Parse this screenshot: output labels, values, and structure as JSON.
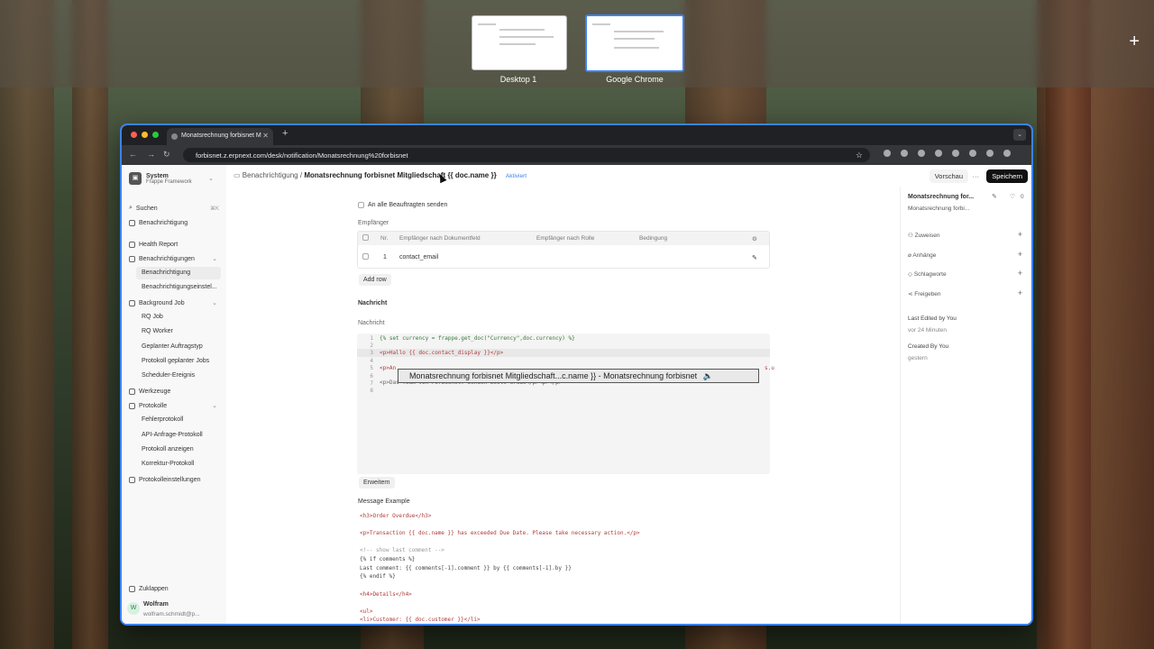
{
  "mission_control": {
    "spaces": [
      {
        "label": "Desktop 1"
      },
      {
        "label": "Google Chrome"
      }
    ],
    "add_label": "+"
  },
  "browser": {
    "tab_title": "Monatsrechnung forbisnet M",
    "url": "forbisnet.z.erpnext.com/desk/notification/Monatsrechnung%20forbisnet"
  },
  "sidebar": {
    "org": "System",
    "org_sub": "Frappe Framework",
    "search": "Suchen",
    "search_shortcut": "⌘K",
    "items": [
      {
        "label": "Benachrichtigung"
      },
      {
        "label": "Health Report"
      },
      {
        "label": "Benachrichtigungen"
      },
      {
        "label": "Benachrichtigung"
      },
      {
        "label": "Benachrichtigungseinstel..."
      },
      {
        "label": "Background Job"
      },
      {
        "label": "RQ Job"
      },
      {
        "label": "RQ Worker"
      },
      {
        "label": "Geplanter Auftragstyp"
      },
      {
        "label": "Protokoll geplanter Jobs"
      },
      {
        "label": "Scheduler-Ereignis"
      },
      {
        "label": "Werkzeuge"
      },
      {
        "label": "Protokolle"
      },
      {
        "label": "Fehlerprotokoll"
      },
      {
        "label": "API-Anfrage-Protokoll"
      },
      {
        "label": "Protokoll anzeigen"
      },
      {
        "label": "Korrektur-Protokoll"
      },
      {
        "label": "Protokolleinstellungen"
      }
    ],
    "collapse": "Zuklappen",
    "user_name": "Wolfram",
    "user_email": "wolfram.schmidt@p...",
    "user_initial": "W"
  },
  "header": {
    "breadcrumb_parent": "Benachrichtigung",
    "separator": "/",
    "title": "Monatsrechnung forbisnet Mitgliedschaft {{ doc.name }}",
    "status": "Aktiviert",
    "preview": "Vorschau",
    "more": "···",
    "save": "Speichern"
  },
  "form": {
    "send_all_label": "An alle Beauftragten senden",
    "recipients_label": "Empfänger",
    "grid_headers": [
      "Nr.",
      "Empfänger nach Dokumentfeld",
      "Empfänger nach Rolle",
      "Bedingung"
    ],
    "grid_rows": [
      {
        "no": "1",
        "field": "contact_email",
        "role": "",
        "condition": ""
      }
    ],
    "add_row": "Add row",
    "message_section": "Nachricht",
    "message_label": "Nachricht",
    "code_lines": [
      "1",
      "2",
      "3",
      "4",
      "5",
      "6",
      "7",
      "8"
    ],
    "code_line1": "{% set currency = frappe.get_doc(\"Currency\",doc.currency) %}",
    "code_line3": "<p>Hallo {{ doc.contact_display }}</p>",
    "code_line5_start": "<p>An",
    "code_line5_end": "s.u",
    "code_line6": "<p>Das Team von Forbisnet. Senden beste Grüße</p><p></p>",
    "tooltip": "Monatsrechnung forbisnet Mitgliedschaft...c.name }} - Monatsrechnung forbisnet",
    "expand": "Erweitern",
    "example_title": "Message Example",
    "example_lines": [
      "<h3>Order Overdue</h3>",
      "<p>Transaction {{ doc.name }} has exceeded Due Date. Please take necessary action.</p>",
      "<!-- show last comment -->",
      "{% if comments %}",
      "Last comment: {{ comments[-1].comment }} by {{ comments[-1].by }}",
      "{% endif %}",
      "<h4>Details</h4>",
      "<ul>",
      "<li>Customer: {{ doc.customer }}</li>"
    ]
  },
  "right_panel": {
    "title": "Monatsrechnung for...",
    "subtitle": "Monatsrechnung forbi...",
    "likes": "0",
    "actions": [
      "Zuweisen",
      "Anhänge",
      "Schlagworte",
      "Freigeben"
    ],
    "last_edited": "Last Edited by You",
    "last_edited_time": "vor 24 Minuten",
    "created": "Created By You",
    "created_time": "gestern"
  }
}
